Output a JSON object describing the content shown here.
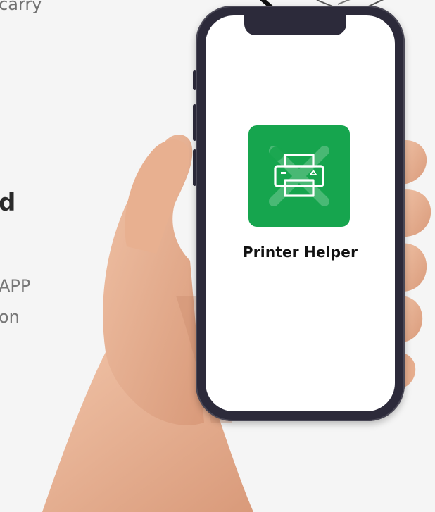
{
  "left_text": {
    "line1": "carry",
    "line2": "d",
    "line3": "APP",
    "line4": "on"
  },
  "phone": {
    "app": {
      "name": "Printer Helper",
      "icon": "printer-wrench-icon",
      "tile_color": "#16a54e"
    }
  },
  "colors": {
    "background": "#f5f5f5",
    "phone_frame": "#2c2a3a",
    "screen": "#ffffff"
  }
}
